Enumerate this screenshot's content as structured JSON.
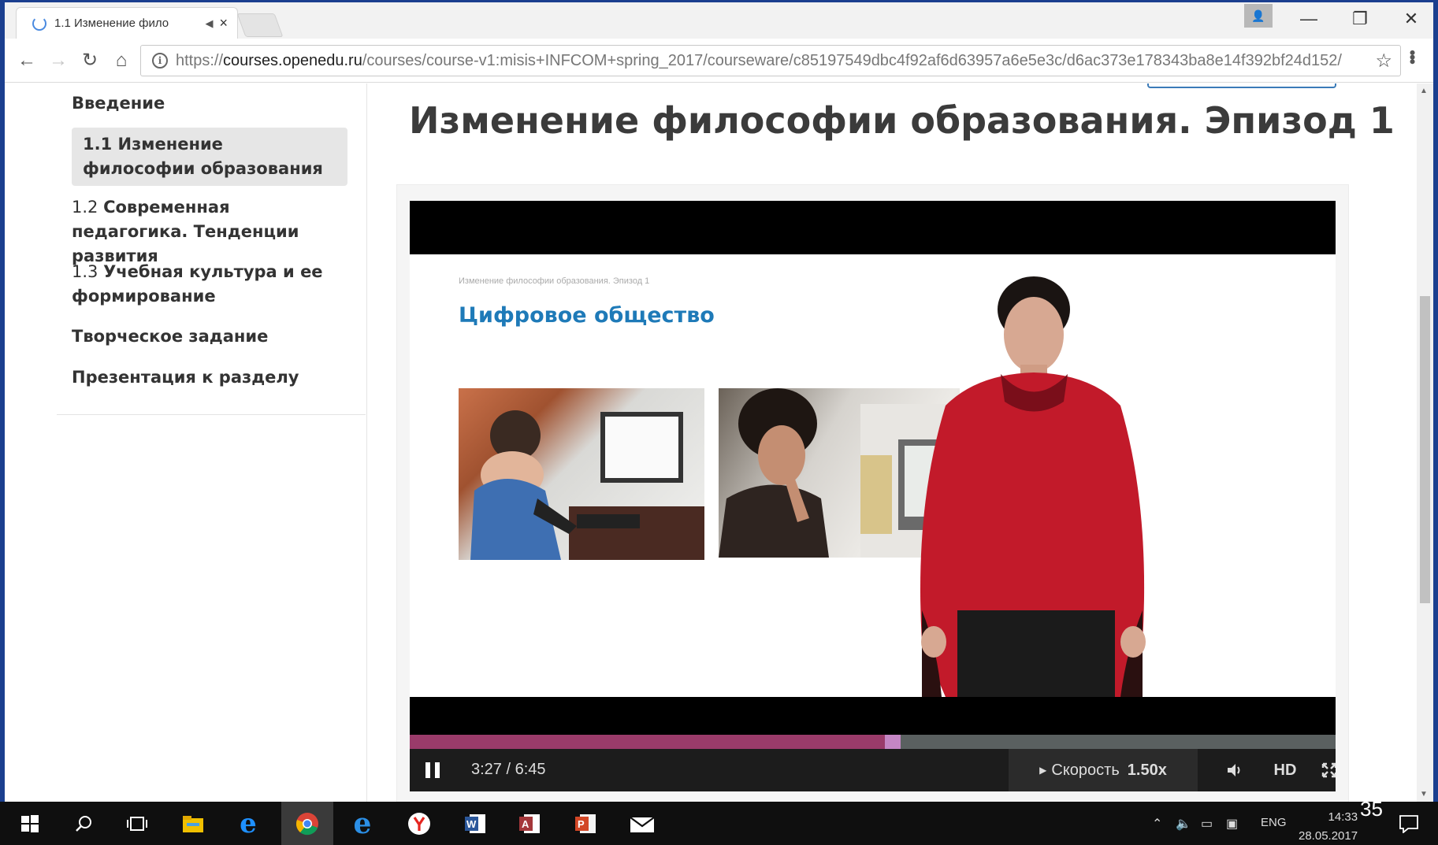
{
  "browser": {
    "tab_title": "1.1 Изменение фило",
    "tab_mute": "◀×",
    "tab_close": "×",
    "url_scheme": "https://",
    "url_host": "courses.openedu.ru",
    "url_path": "/courses/course-v1:misis+INFCOM+spring_2017/courseware/c85197549dbc4f92af6d63957a6e5e3c/d6ac373e178343ba8e14f392bf24d152/",
    "back_icon": "←",
    "forward_icon": "→",
    "reload_icon": "↻",
    "home_icon": "⌂",
    "star_icon": "☆",
    "menu_icon": "⋮",
    "minimize": "—",
    "restore": "❐",
    "close": "✕"
  },
  "sidebar": {
    "items": [
      {
        "num": "",
        "label": "Введение"
      },
      {
        "num": "1.1 ",
        "label": "Изменение философии образования"
      },
      {
        "num": "1.2 ",
        "label": "Современная педагогика. Тенденции развития"
      },
      {
        "num": "1.3 ",
        "label": "Учебная культура и ее формирование"
      },
      {
        "num": "",
        "label": "Творческое задание"
      },
      {
        "num": "",
        "label": "Презентация к разделу"
      }
    ]
  },
  "main": {
    "title": "Изменение философии образования. Эпизод 1"
  },
  "video": {
    "slide_caption": "Изменение философии образования. Эпизод 1",
    "slide_heading": "Цифровое общество",
    "time": "3:27 / 6:45",
    "progress": 0.513,
    "speed_label": "Скорость",
    "speed_value": "1.50x",
    "volume_icon": "🔊",
    "hd_label": "HD",
    "fullscreen_icon": "⤢",
    "accent_color": "#9a3b6a"
  },
  "taskbar": {
    "lang": "ENG",
    "time": "14:33",
    "date": "28.05.2017",
    "apps": [
      "start-icon",
      "search-icon",
      "task-view-icon",
      "file-explorer-icon",
      "edge-icon",
      "chrome-icon",
      "ie-icon",
      "yandex-icon",
      "word-icon",
      "access-icon",
      "powerpoint-icon",
      "mail-icon"
    ]
  },
  "slide_number": "35"
}
